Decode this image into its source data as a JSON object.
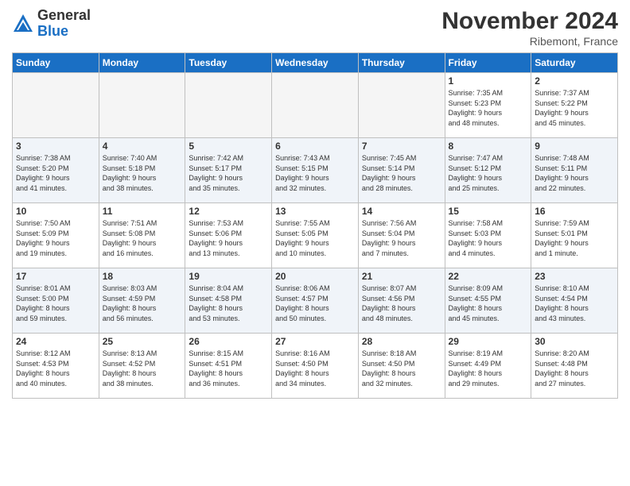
{
  "logo": {
    "general": "General",
    "blue": "Blue"
  },
  "title": "November 2024",
  "location": "Ribemont, France",
  "days_of_week": [
    "Sunday",
    "Monday",
    "Tuesday",
    "Wednesday",
    "Thursday",
    "Friday",
    "Saturday"
  ],
  "weeks": [
    [
      {
        "day": "",
        "info": ""
      },
      {
        "day": "",
        "info": ""
      },
      {
        "day": "",
        "info": ""
      },
      {
        "day": "",
        "info": ""
      },
      {
        "day": "",
        "info": ""
      },
      {
        "day": "1",
        "info": "Sunrise: 7:35 AM\nSunset: 5:23 PM\nDaylight: 9 hours\nand 48 minutes."
      },
      {
        "day": "2",
        "info": "Sunrise: 7:37 AM\nSunset: 5:22 PM\nDaylight: 9 hours\nand 45 minutes."
      }
    ],
    [
      {
        "day": "3",
        "info": "Sunrise: 7:38 AM\nSunset: 5:20 PM\nDaylight: 9 hours\nand 41 minutes."
      },
      {
        "day": "4",
        "info": "Sunrise: 7:40 AM\nSunset: 5:18 PM\nDaylight: 9 hours\nand 38 minutes."
      },
      {
        "day": "5",
        "info": "Sunrise: 7:42 AM\nSunset: 5:17 PM\nDaylight: 9 hours\nand 35 minutes."
      },
      {
        "day": "6",
        "info": "Sunrise: 7:43 AM\nSunset: 5:15 PM\nDaylight: 9 hours\nand 32 minutes."
      },
      {
        "day": "7",
        "info": "Sunrise: 7:45 AM\nSunset: 5:14 PM\nDaylight: 9 hours\nand 28 minutes."
      },
      {
        "day": "8",
        "info": "Sunrise: 7:47 AM\nSunset: 5:12 PM\nDaylight: 9 hours\nand 25 minutes."
      },
      {
        "day": "9",
        "info": "Sunrise: 7:48 AM\nSunset: 5:11 PM\nDaylight: 9 hours\nand 22 minutes."
      }
    ],
    [
      {
        "day": "10",
        "info": "Sunrise: 7:50 AM\nSunset: 5:09 PM\nDaylight: 9 hours\nand 19 minutes."
      },
      {
        "day": "11",
        "info": "Sunrise: 7:51 AM\nSunset: 5:08 PM\nDaylight: 9 hours\nand 16 minutes."
      },
      {
        "day": "12",
        "info": "Sunrise: 7:53 AM\nSunset: 5:06 PM\nDaylight: 9 hours\nand 13 minutes."
      },
      {
        "day": "13",
        "info": "Sunrise: 7:55 AM\nSunset: 5:05 PM\nDaylight: 9 hours\nand 10 minutes."
      },
      {
        "day": "14",
        "info": "Sunrise: 7:56 AM\nSunset: 5:04 PM\nDaylight: 9 hours\nand 7 minutes."
      },
      {
        "day": "15",
        "info": "Sunrise: 7:58 AM\nSunset: 5:03 PM\nDaylight: 9 hours\nand 4 minutes."
      },
      {
        "day": "16",
        "info": "Sunrise: 7:59 AM\nSunset: 5:01 PM\nDaylight: 9 hours\nand 1 minute."
      }
    ],
    [
      {
        "day": "17",
        "info": "Sunrise: 8:01 AM\nSunset: 5:00 PM\nDaylight: 8 hours\nand 59 minutes."
      },
      {
        "day": "18",
        "info": "Sunrise: 8:03 AM\nSunset: 4:59 PM\nDaylight: 8 hours\nand 56 minutes."
      },
      {
        "day": "19",
        "info": "Sunrise: 8:04 AM\nSunset: 4:58 PM\nDaylight: 8 hours\nand 53 minutes."
      },
      {
        "day": "20",
        "info": "Sunrise: 8:06 AM\nSunset: 4:57 PM\nDaylight: 8 hours\nand 50 minutes."
      },
      {
        "day": "21",
        "info": "Sunrise: 8:07 AM\nSunset: 4:56 PM\nDaylight: 8 hours\nand 48 minutes."
      },
      {
        "day": "22",
        "info": "Sunrise: 8:09 AM\nSunset: 4:55 PM\nDaylight: 8 hours\nand 45 minutes."
      },
      {
        "day": "23",
        "info": "Sunrise: 8:10 AM\nSunset: 4:54 PM\nDaylight: 8 hours\nand 43 minutes."
      }
    ],
    [
      {
        "day": "24",
        "info": "Sunrise: 8:12 AM\nSunset: 4:53 PM\nDaylight: 8 hours\nand 40 minutes."
      },
      {
        "day": "25",
        "info": "Sunrise: 8:13 AM\nSunset: 4:52 PM\nDaylight: 8 hours\nand 38 minutes."
      },
      {
        "day": "26",
        "info": "Sunrise: 8:15 AM\nSunset: 4:51 PM\nDaylight: 8 hours\nand 36 minutes."
      },
      {
        "day": "27",
        "info": "Sunrise: 8:16 AM\nSunset: 4:50 PM\nDaylight: 8 hours\nand 34 minutes."
      },
      {
        "day": "28",
        "info": "Sunrise: 8:18 AM\nSunset: 4:50 PM\nDaylight: 8 hours\nand 32 minutes."
      },
      {
        "day": "29",
        "info": "Sunrise: 8:19 AM\nSunset: 4:49 PM\nDaylight: 8 hours\nand 29 minutes."
      },
      {
        "day": "30",
        "info": "Sunrise: 8:20 AM\nSunset: 4:48 PM\nDaylight: 8 hours\nand 27 minutes."
      }
    ]
  ]
}
